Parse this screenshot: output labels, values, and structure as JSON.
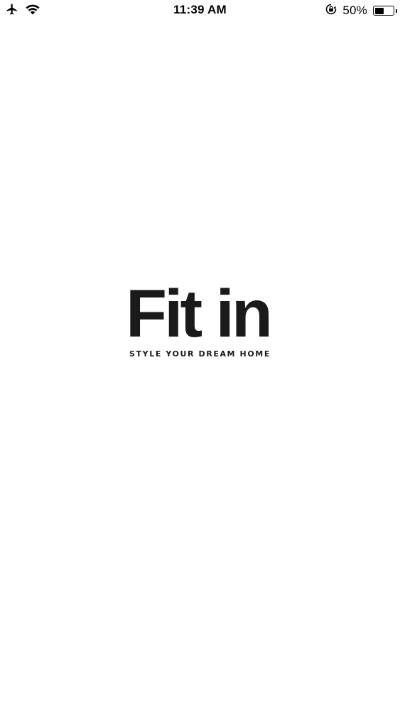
{
  "status_bar": {
    "time": "11:39 AM",
    "battery_percent_label": "50%",
    "battery_level": 0.5,
    "icons": [
      "airplane-icon",
      "wifi-icon",
      "orientation-lock-icon",
      "battery-icon"
    ]
  },
  "splash": {
    "logo_text": "Fit in",
    "tagline": "STYLE YOUR DREAM HOME"
  },
  "colors": {
    "background": "#ffffff",
    "logo": "#1a1a1a"
  }
}
